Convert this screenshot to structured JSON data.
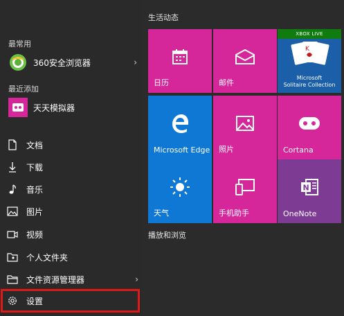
{
  "left": {
    "most_used_label": "最常用",
    "recent_label": "最近添加",
    "apps": [
      {
        "label": "360安全浏览器",
        "icon": "360-browser-icon"
      },
      {
        "label": "天天模拟器",
        "icon": "tiantian-emulator-icon"
      }
    ],
    "nav": [
      {
        "label": "文档",
        "icon": "document-icon"
      },
      {
        "label": "下载",
        "icon": "download-icon"
      },
      {
        "label": "音乐",
        "icon": "music-icon"
      },
      {
        "label": "图片",
        "icon": "picture-icon"
      },
      {
        "label": "视频",
        "icon": "video-icon"
      },
      {
        "label": "个人文件夹",
        "icon": "user-folder-icon"
      },
      {
        "label": "文件资源管理器",
        "icon": "file-explorer-icon"
      },
      {
        "label": "设置",
        "icon": "gear-icon"
      }
    ]
  },
  "tiles": {
    "group1": "生活动态",
    "group2": "播放和浏览",
    "items": [
      {
        "label": "日历",
        "color": "#d5279a"
      },
      {
        "label": "邮件",
        "color": "#d5279a"
      },
      {
        "label": "Microsoft Solitaire Collection",
        "badge": "XBOX LIVE",
        "line1": "Microsoft",
        "line2": "Solitaire Collection",
        "color": "#1e7b2d"
      },
      {
        "label": "Microsoft Edge",
        "color": "#0f78d4"
      },
      {
        "label": "照片",
        "color": "#d5279a"
      },
      {
        "label": "Cortana",
        "color": "#d5279a"
      },
      {
        "label": "天气",
        "color": "#0f78d4"
      },
      {
        "label": "手机助手",
        "color": "#d5279a"
      },
      {
        "label": "OneNote",
        "color": "#7d3b94"
      }
    ]
  },
  "colors": {
    "highlight": "#e01818",
    "magenta": "#d5279a",
    "blue": "#0f78d4",
    "purple": "#7d3b94"
  }
}
